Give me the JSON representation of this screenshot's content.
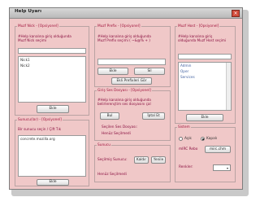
{
  "window": {
    "title": "Help Uyarı",
    "close_glyph": "×"
  },
  "nick": {
    "group_title": "Muzf Nick - [Opsiyonel]",
    "note_line1": "#Help kanalına giriş olduğunda",
    "note_line2": "Muzf Nick seçimi",
    "input_value": "",
    "list": [
      "Nick1",
      "Nick2"
    ],
    "edit_button": "Ekle"
  },
  "prefix": {
    "group_title": "Muzf Prefix - [Opsiyonel]",
    "note_line1": "#Help kanalına giriş olduğunda",
    "note_line2": "Muzf Prefix seçimi ( ~&@% + )",
    "input_value": "",
    "add_button": "Ekle",
    "delete_button": "Sil",
    "edit_button": "Ekli Prefixleri Gör"
  },
  "host": {
    "group_title": "Muzf Host - [Opsiyonel]",
    "note_line1": "#Help kanalına giriş",
    "note_line2": "olduğunda Muzf Host seçimi",
    "input_value": "",
    "list": [
      "Admin",
      "Oper",
      "Services"
    ],
    "add_button": "Ekle"
  },
  "sound": {
    "group_title": "Giriş Ses Dosyası - [Opsiyonel]",
    "note_line1": "#Help kanalına giriş olduğunda",
    "note_line2": "belirlerençtim ses dosyasını çal",
    "find_button": "Bul",
    "cancel_button": "İptal Et",
    "selected_label": "Seçilen Ses Dosyası:",
    "selected_value": "Henüz Seçilmedi"
  },
  "server": {
    "group_title": "Sunucu(lar) - [Opsiyonel]",
    "note": "Bir sunucu seçin / Çift Tık",
    "list": [
      "concrete.mozilla.org"
    ],
    "add_button": "Ekle"
  },
  "sunucu": {
    "group_title": "Sunucu",
    "selected_label": "Seçilmiş Sunucu:",
    "remove_button": "Kaldır",
    "refresh_button": "Yenile",
    "selected_value": "Henüz Seçilmedi"
  },
  "system": {
    "group_title": "Sistem",
    "open_label": "Açık",
    "closed_label": "Kapalı",
    "mirc_label": "mIRC Rebo",
    "mirc_button": "mirc.chm",
    "colors_label": "Renkler:",
    "colors_value": ""
  },
  "colors": {
    "accent": "#a0143c",
    "window_bg": "#f0c8c8"
  }
}
